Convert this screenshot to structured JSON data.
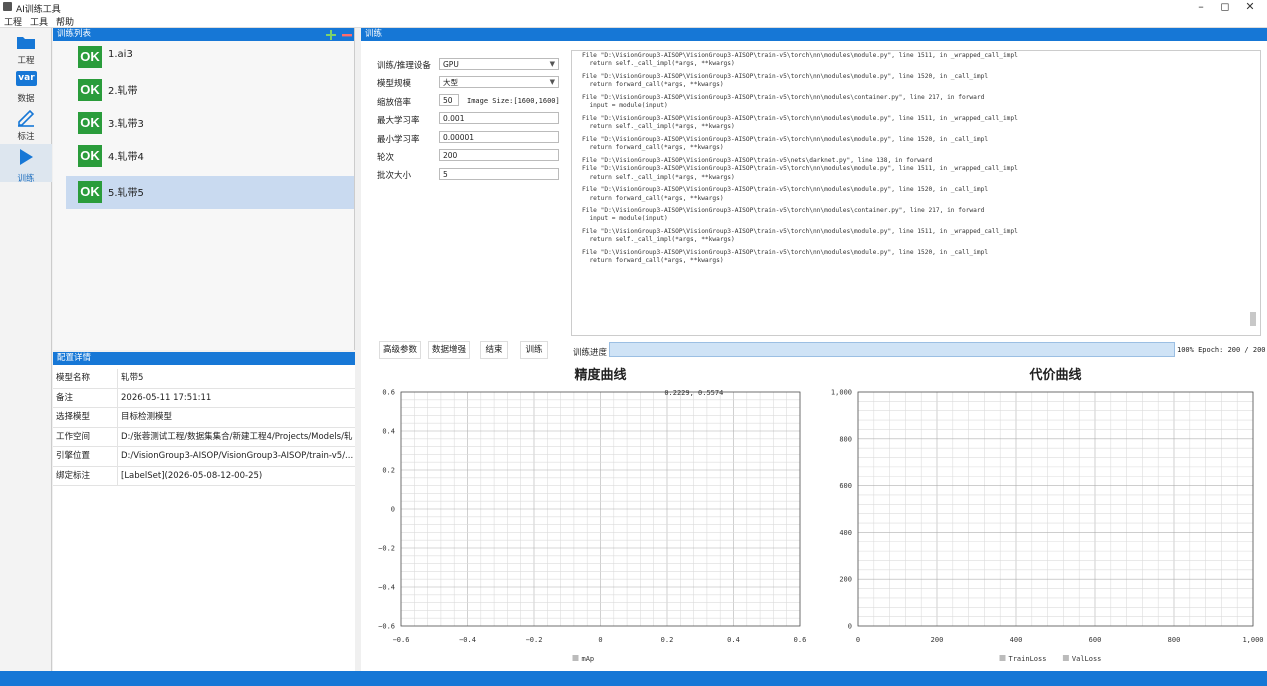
{
  "window": {
    "title": "AI训练工具",
    "min": "–",
    "max": "◻",
    "close": "✕"
  },
  "menu": [
    "工程",
    "工具",
    "帮助"
  ],
  "nav": [
    {
      "label": "工程",
      "icon": "folder-icon"
    },
    {
      "label": "数据",
      "icon": "var-icon"
    },
    {
      "label": "标注",
      "icon": "pencil-icon"
    },
    {
      "label": "训练",
      "icon": "play-icon"
    }
  ],
  "nav_var_text": "var",
  "list_panel": {
    "title": "训练列表",
    "items": [
      {
        "badge": "OK",
        "name": "1.ai3"
      },
      {
        "badge": "OK",
        "name": "2.轧带"
      },
      {
        "badge": "OK",
        "name": "3.轧带3"
      },
      {
        "badge": "OK",
        "name": "4.轧带4"
      },
      {
        "badge": "OK",
        "name": "5.轧带5"
      }
    ]
  },
  "config_panel": {
    "title": "配置详情",
    "rows": [
      {
        "k": "模型名称",
        "v": "轧带5"
      },
      {
        "k": "备注",
        "v": "2026-05-11 17:51:11"
      },
      {
        "k": "选择模型",
        "v": "目标检测模型"
      },
      {
        "k": "工作空间",
        "v": "D:/张蓉测试工程/数据集集合/新建工程4/Projects/Models/轧..."
      },
      {
        "k": "引擎位置",
        "v": "D:/VisionGroup3-AISOP/VisionGroup3-AISOP/train-v5/..."
      },
      {
        "k": "绑定标注",
        "v": "[LabelSet](2026-05-08-12-00-25)"
      }
    ]
  },
  "train_panel": {
    "title": "训练"
  },
  "form": {
    "device": {
      "label": "训练/推理设备",
      "value": "GPU"
    },
    "scale": {
      "label": "模型规模",
      "value": "大型"
    },
    "zoom": {
      "label": "缩放倍率",
      "value": "50",
      "hint": "Image Size:[1600,1600]"
    },
    "max_lr": {
      "label": "最大学习率",
      "value": "0.001"
    },
    "min_lr": {
      "label": "最小学习率",
      "value": "0.00001"
    },
    "epochs": {
      "label": "轮次",
      "value": "200"
    },
    "batch": {
      "label": "批次大小",
      "value": "5"
    }
  },
  "log_lines": [
    "File \"D:\\VisionGroup3-AISOP\\VisionGroup3-AISOP\\train-v5\\torch\\nn\\modules\\module.py\", line 1511, in _wrapped_call_impl",
    "  return self._call_impl(*args, **kwargs)",
    "",
    "File \"D:\\VisionGroup3-AISOP\\VisionGroup3-AISOP\\train-v5\\torch\\nn\\modules\\module.py\", line 1520, in _call_impl",
    "  return forward_call(*args, **kwargs)",
    "",
    "File \"D:\\VisionGroup3-AISOP\\VisionGroup3-AISOP\\train-v5\\torch\\nn\\modules\\container.py\", line 217, in forward",
    "  input = module(input)",
    "",
    "File \"D:\\VisionGroup3-AISOP\\VisionGroup3-AISOP\\train-v5\\torch\\nn\\modules\\module.py\", line 1511, in _wrapped_call_impl",
    "  return self._call_impl(*args, **kwargs)",
    "",
    "File \"D:\\VisionGroup3-AISOP\\VisionGroup3-AISOP\\train-v5\\torch\\nn\\modules\\module.py\", line 1520, in _call_impl",
    "  return forward_call(*args, **kwargs)",
    "",
    "File \"D:\\VisionGroup3-AISOP\\VisionGroup3-AISOP\\train-v5\\nets\\darknet.py\", line 138, in forward",
    "File \"D:\\VisionGroup3-AISOP\\VisionGroup3-AISOP\\train-v5\\torch\\nn\\modules\\module.py\", line 1511, in _wrapped_call_impl",
    "  return self._call_impl(*args, **kwargs)",
    "",
    "File \"D:\\VisionGroup3-AISOP\\VisionGroup3-AISOP\\train-v5\\torch\\nn\\modules\\module.py\", line 1520, in _call_impl",
    "  return forward_call(*args, **kwargs)",
    "",
    "File \"D:\\VisionGroup3-AISOP\\VisionGroup3-AISOP\\train-v5\\torch\\nn\\modules\\container.py\", line 217, in forward",
    "  input = module(input)",
    "",
    "File \"D:\\VisionGroup3-AISOP\\VisionGroup3-AISOP\\train-v5\\torch\\nn\\modules\\module.py\", line 1511, in _wrapped_call_impl",
    "  return self._call_impl(*args, **kwargs)",
    "",
    "File \"D:\\VisionGroup3-AISOP\\VisionGroup3-AISOP\\train-v5\\torch\\nn\\modules\\module.py\", line 1520, in _call_impl",
    "  return forward_call(*args, **kwargs)"
  ],
  "buttons": {
    "advanced": "高级参数",
    "augment": "数据增强",
    "stop": "结束",
    "train": "训练"
  },
  "progress": {
    "label": "训练进度",
    "value": 1.0,
    "text": "100%",
    "epoch": "Epoch: 200 / 200"
  },
  "chart_data": [
    {
      "type": "scatter",
      "title": "精度曲线",
      "xlim": [
        -0.6,
        0.6
      ],
      "ylim": [
        -0.6,
        0.6
      ],
      "xticks": [
        "−0.6",
        "−0.4",
        "−0.2",
        "0",
        "0.2",
        "0.4",
        "0.6"
      ],
      "yticks": [
        "−0.6",
        "−0.4",
        "−0.2",
        "0",
        "0.2",
        "0.4",
        "0.6"
      ],
      "legend": [
        "mAp"
      ],
      "annotation": "0.2229, 0.5574",
      "grid": true
    },
    {
      "type": "line",
      "title": "代价曲线",
      "xlim": [
        0,
        1000
      ],
      "ylim": [
        0,
        1000
      ],
      "xticks": [
        "0",
        "200",
        "400",
        "600",
        "800",
        "1,000"
      ],
      "yticks": [
        "0",
        "200",
        "400",
        "600",
        "800",
        "1,000"
      ],
      "legend": [
        "TrainLoss",
        "ValLoss"
      ],
      "grid": true
    }
  ]
}
